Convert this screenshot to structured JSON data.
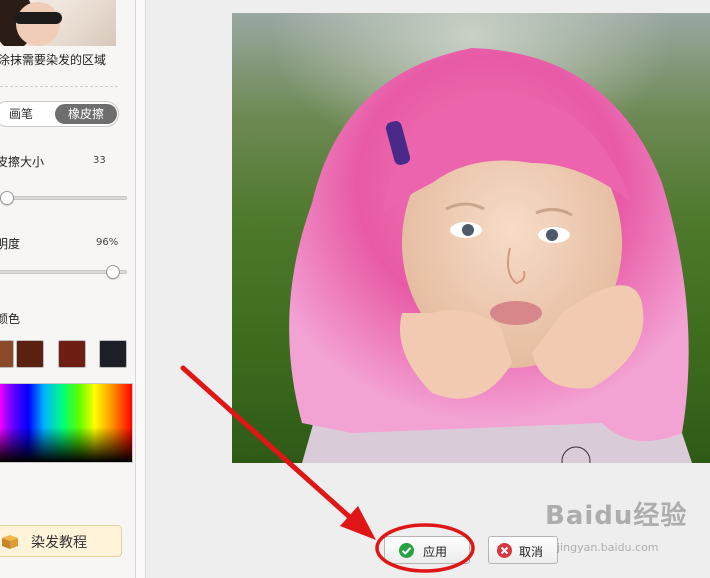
{
  "left_panel": {
    "hint": "涂抹需要染发的区域",
    "modes": {
      "brush": "画笔",
      "eraser": "橡皮擦",
      "active": "eraser"
    },
    "eraser_size": {
      "label": "皮擦大小",
      "value": "33"
    },
    "opacity": {
      "label": "明度",
      "value": "96%"
    },
    "color_section": {
      "label": "颜色"
    },
    "swatches": [
      "#8a4a2a",
      "#5a2010",
      "#6e1e12",
      "#1c2026"
    ],
    "tutorial_button": "染发教程"
  },
  "actions": {
    "apply": "应用",
    "cancel": "取消"
  },
  "colors": {
    "apply_icon": "#27a243",
    "cancel_icon": "#d9363e",
    "annotation": "#e01515",
    "active_mode": "#6e6e6e"
  },
  "watermark": {
    "logo": "Baidu经验",
    "url": "jingyan.baidu.com"
  }
}
